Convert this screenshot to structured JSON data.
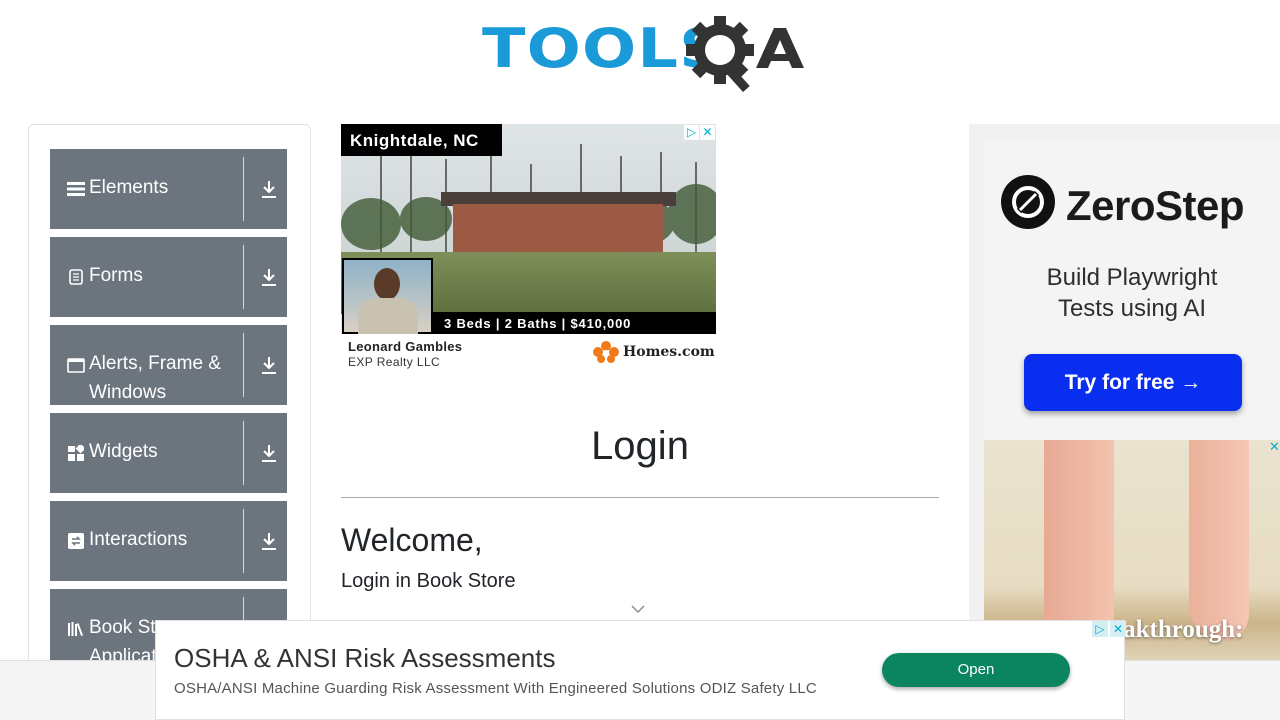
{
  "header": {
    "logo_text": "TOOLS",
    "logo_suffix": "QA"
  },
  "sidebar": {
    "groups": [
      {
        "label": "Elements",
        "icon": "hamburger-icon"
      },
      {
        "label": "Forms",
        "icon": "document-icon"
      },
      {
        "label": "Alerts, Frame & Windows",
        "icon": "window-icon"
      },
      {
        "label": "Widgets",
        "icon": "widgets-icon"
      },
      {
        "label": "Interactions",
        "icon": "interactions-icon"
      },
      {
        "label": "Book Store Application",
        "icon": "books-icon"
      }
    ],
    "expand_icon": "download-arrow-icon",
    "bg_color": "#6c757d"
  },
  "ad_top": {
    "city": "Knightdale, NC",
    "specs": "3 Beds | 2 Baths | $410,000",
    "agent_name": "Leonard Gambles",
    "agent_company": "EXP Realty LLC",
    "brand": "Homes.com"
  },
  "main": {
    "title": "Login",
    "welcome": "Welcome,",
    "subtitle": "Login in Book Store"
  },
  "ad_right": {
    "brand": "ZeroStep",
    "tagline_line1": "Build Playwright",
    "tagline_line2": "Tests using AI",
    "cta": "Try for free →",
    "lower_text": "eakthrough:"
  },
  "bottom_ad": {
    "title": "OSHA & ANSI Risk Assessments",
    "description": "OSHA/ANSI Machine Guarding Risk Assessment With Engineered Solutions ODIZ Safety LLC",
    "cta": "Open",
    "cta_color": "#0b8560"
  }
}
